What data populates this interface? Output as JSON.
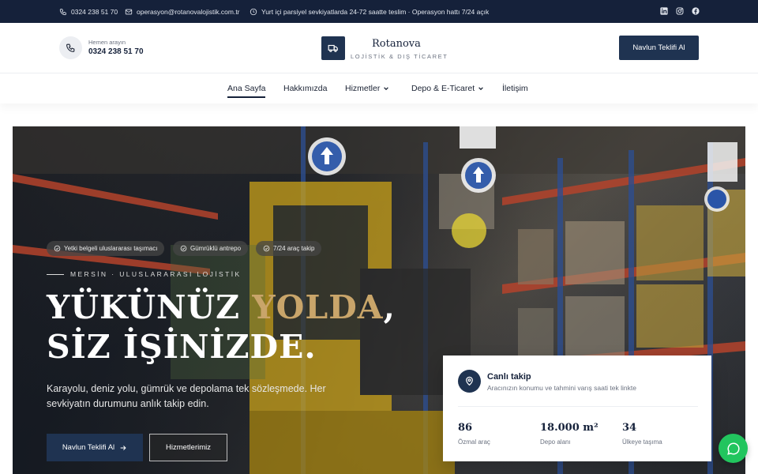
{
  "topbar": {
    "phone": "0324 238 51 70",
    "email": "operasyon@rotanovalojistik.com.tr",
    "notice": "Yurt içi parsiyel sevkiyatlarda 24-72 saatte teslim · Operasyon hattı 7/24 açık",
    "icons": [
      "phone-icon",
      "mail-icon",
      "clock-icon",
      "linkedin-icon",
      "instagram-icon",
      "facebook-icon"
    ]
  },
  "header": {
    "phone_label": "Hemen arayın",
    "phone_number": "0324 238 51 70",
    "brand": "Rotanova",
    "tagline": "LOJİSTİK & DIŞ TİCARET",
    "cta": "Navlun Teklifi Al"
  },
  "nav": {
    "items": [
      {
        "label": "Ana Sayfa",
        "active": true
      },
      {
        "label": "Hakkımızda"
      },
      {
        "label": "Hizmetler",
        "dropdown": true
      },
      {
        "label": "Depo & E-Ticaret",
        "dropdown": true
      },
      {
        "label": "İletişim"
      }
    ]
  },
  "hero": {
    "badges": [
      "Yetki belgeli uluslararası taşımacı",
      "Gümrüklü antrepo",
      "7/24 araç takip"
    ],
    "eyebrow": "MERSİN · ULUSLARARASI LOJİSTİK",
    "headline_line1_a": "YÜKÜNÜZ",
    "headline_line1_accent": "YOLDA",
    "headline_line1_b": ",",
    "headline_line2": "SİZ İŞİNİZDE.",
    "subtext": "Karayolu, deniz yolu, gümrük ve depolama tek sözleşmede. Her sevkiyatın durumunu anlık takip edin.",
    "primary_button": "Navlun Teklifi Al",
    "secondary_button": "Hizmetlerimiz"
  },
  "tracking_card": {
    "title": "Canlı takip",
    "subtitle": "Aracınızın konumu ve tahmini varış saati tek linkte",
    "stats": [
      {
        "value": "86",
        "label": "Özmal araç"
      },
      {
        "value": "18.000 m²",
        "label": "Depo alanı"
      },
      {
        "value": "34",
        "label": "Ülkeye taşıma"
      }
    ]
  },
  "colors": {
    "navy": "#15213a",
    "button": "#1f3351",
    "accent_gold": "#c9a56a",
    "whatsapp": "#22c55e"
  }
}
